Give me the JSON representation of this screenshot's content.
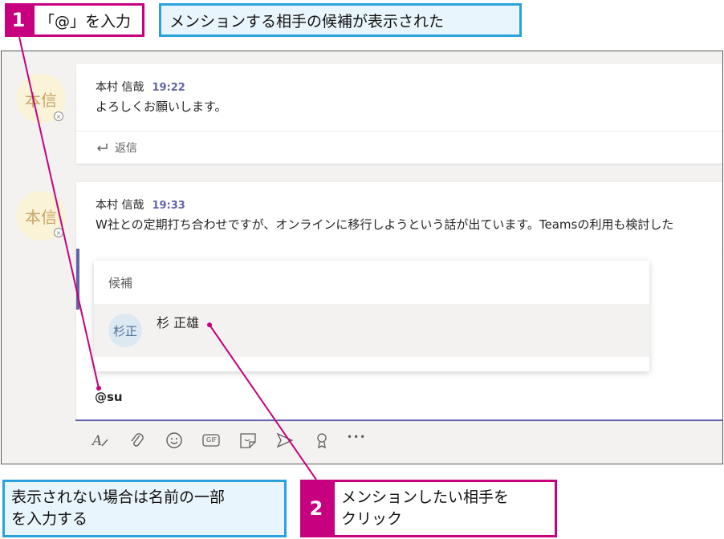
{
  "callouts": {
    "step1": {
      "number": "1",
      "text": "「@」を入力"
    },
    "step1_note": "メンションする相手の候補が表示された",
    "step2": {
      "number": "2",
      "text_line1": "メンションしたい相手を",
      "text_line2": "クリック"
    },
    "bottom_note": {
      "line1": "表示されない場合は名前の一部",
      "line2": "を入力する"
    }
  },
  "messages": [
    {
      "avatar_initials": "本信",
      "author": "本村 信哉",
      "time": "19:22",
      "text": "よろしくお願いします。",
      "reply_label": "返信"
    },
    {
      "avatar_initials": "本信",
      "author": "本村 信哉",
      "time": "19:33",
      "text": "W社との定期打ち合わせですが、オンラインに移行しようという話が出ています。Teamsの利用も検討した"
    }
  ],
  "mention_popup": {
    "header": "候補",
    "suggestions": [
      {
        "initials": "杉正",
        "name": "杉 正雄"
      }
    ]
  },
  "compose": {
    "value": "@su"
  },
  "toolbar": {
    "icons": [
      "format-icon",
      "attach-icon",
      "emoji-icon",
      "gif-icon",
      "sticker-icon",
      "meet-icon",
      "praise-icon",
      "more-icon"
    ],
    "gif_label": "GIF",
    "more_label": "•••"
  },
  "colors": {
    "accent_magenta": "#c6007e",
    "accent_blue": "#2ba2db",
    "teams_purple": "#6264a7"
  }
}
